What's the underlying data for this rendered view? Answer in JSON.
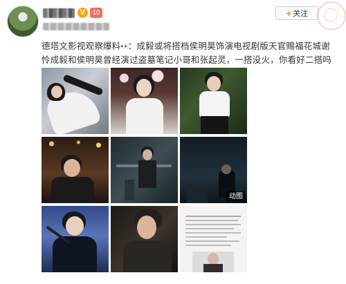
{
  "header": {
    "follow_label": "关注",
    "verified_badge": "V",
    "level_badge": "10"
  },
  "post": {
    "text": "德塔文影视观察爆料",
    "text_rest": "：成毅或将搭档侯明昊饰演电视剧版天官赐福花城谢怜成毅和侯明昊曾经演过盗墓笔记小哥和张起灵，一搭没火，你看好二搭吗"
  },
  "media": {
    "gif_label": "动图"
  },
  "colors": {
    "follow_accent": "#f57c00",
    "verified": "#f7a516",
    "level": "#f76f5b"
  }
}
